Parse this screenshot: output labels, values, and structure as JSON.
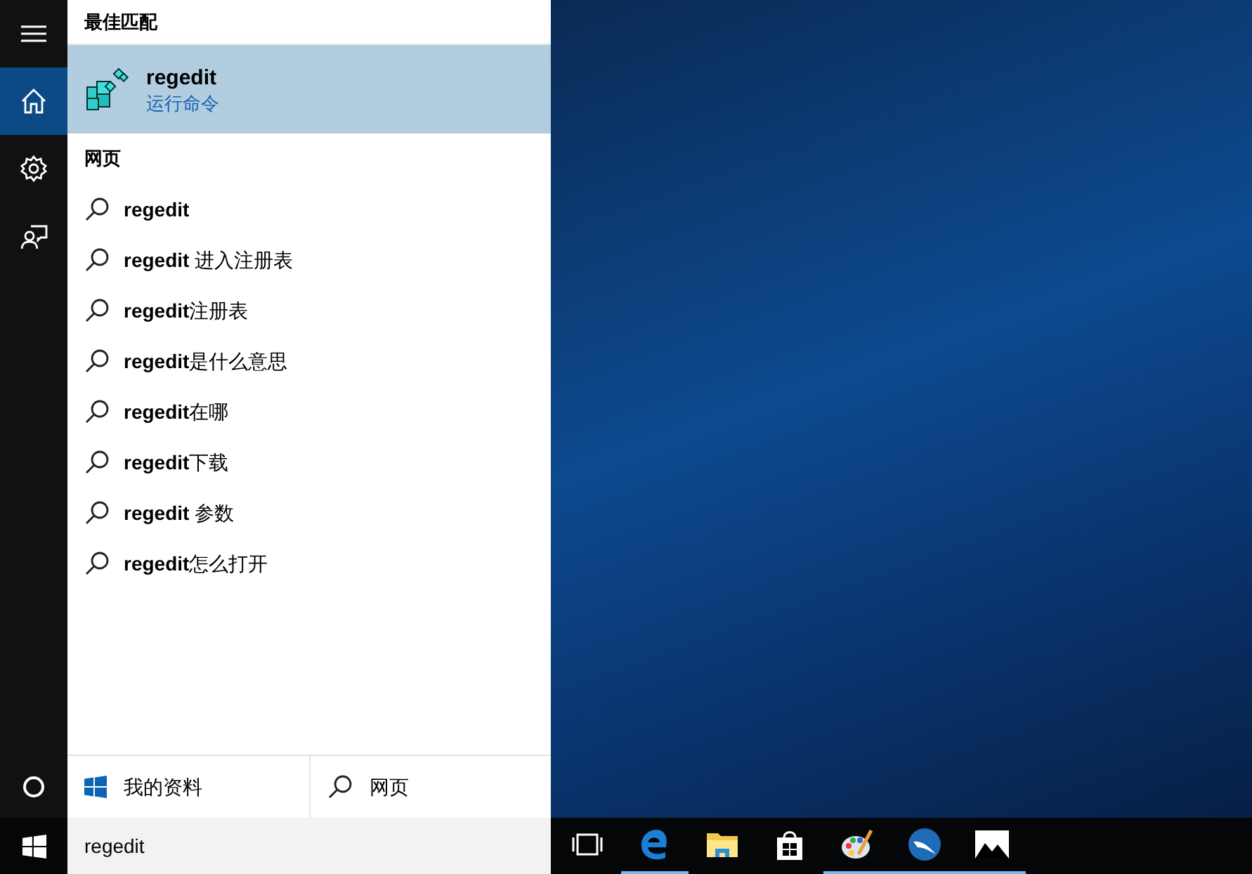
{
  "sidebar": {
    "items": [
      {
        "kind": "menu",
        "selected": false
      },
      {
        "kind": "home",
        "selected": true
      },
      {
        "kind": "settings",
        "selected": false
      },
      {
        "kind": "feedback",
        "selected": false
      }
    ]
  },
  "best_match": {
    "heading": "最佳匹配",
    "title": "regedit",
    "subtitle": "运行命令",
    "selected": true
  },
  "web": {
    "heading": "网页",
    "suggestions": [
      "**regedit**",
      "**regedit** 进入注册表",
      "**regedit**注册表",
      "**regedit**是什么意思",
      "**regedit**在哪",
      "**regedit**下载",
      "**regedit** 参数",
      "**regedit**怎么打开"
    ]
  },
  "filters": [
    {
      "kind": "windows",
      "label": "我的资料"
    },
    {
      "kind": "search",
      "label": "网页"
    }
  ],
  "search": {
    "value": "regedit"
  },
  "taskbar": {
    "apps": [
      {
        "kind": "taskview",
        "running": false
      },
      {
        "kind": "edge",
        "running": true
      },
      {
        "kind": "folder",
        "running": false
      },
      {
        "kind": "store",
        "running": false
      },
      {
        "kind": "paint",
        "running": true
      },
      {
        "kind": "bird",
        "running": true
      },
      {
        "kind": "photos",
        "running": true
      }
    ]
  }
}
